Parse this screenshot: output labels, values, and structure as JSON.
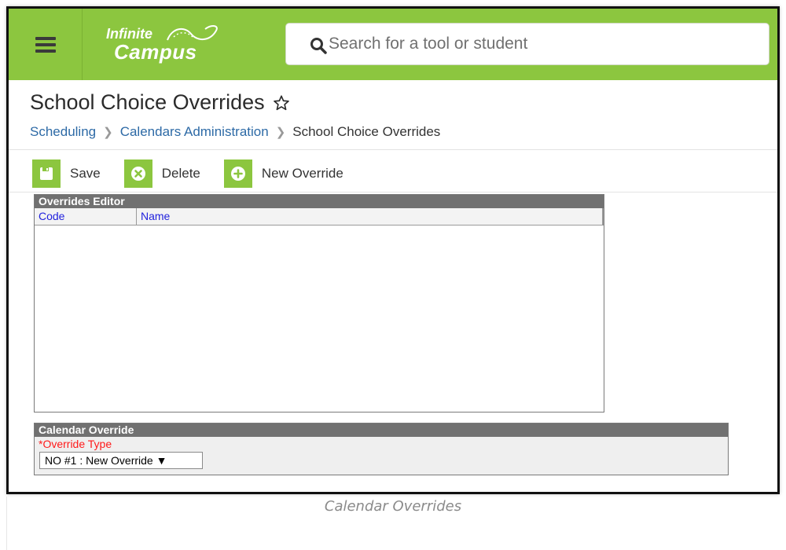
{
  "header": {
    "logo_line1": "Infinite",
    "logo_line2": "Campus",
    "search_placeholder": "Search for a tool or student"
  },
  "page": {
    "title": "School Choice Overrides",
    "breadcrumbs": [
      "Scheduling",
      "Calendars Administration",
      "School Choice Overrides"
    ]
  },
  "toolbar": {
    "save_label": "Save",
    "delete_label": "Delete",
    "new_label": "New Override"
  },
  "overrides_editor": {
    "title": "Overrides Editor",
    "columns": [
      "Code",
      "Name"
    ]
  },
  "calendar_override": {
    "title": "Calendar Override",
    "type_label": "*Override Type",
    "type_value": "NO #1 : New Override ▼"
  },
  "caption": "Calendar Overrides",
  "colors": {
    "brand_green": "#8cc63f",
    "panel_header": "#717171",
    "link_blue": "#2d6aa6",
    "required_red": "#ff1a1a"
  }
}
